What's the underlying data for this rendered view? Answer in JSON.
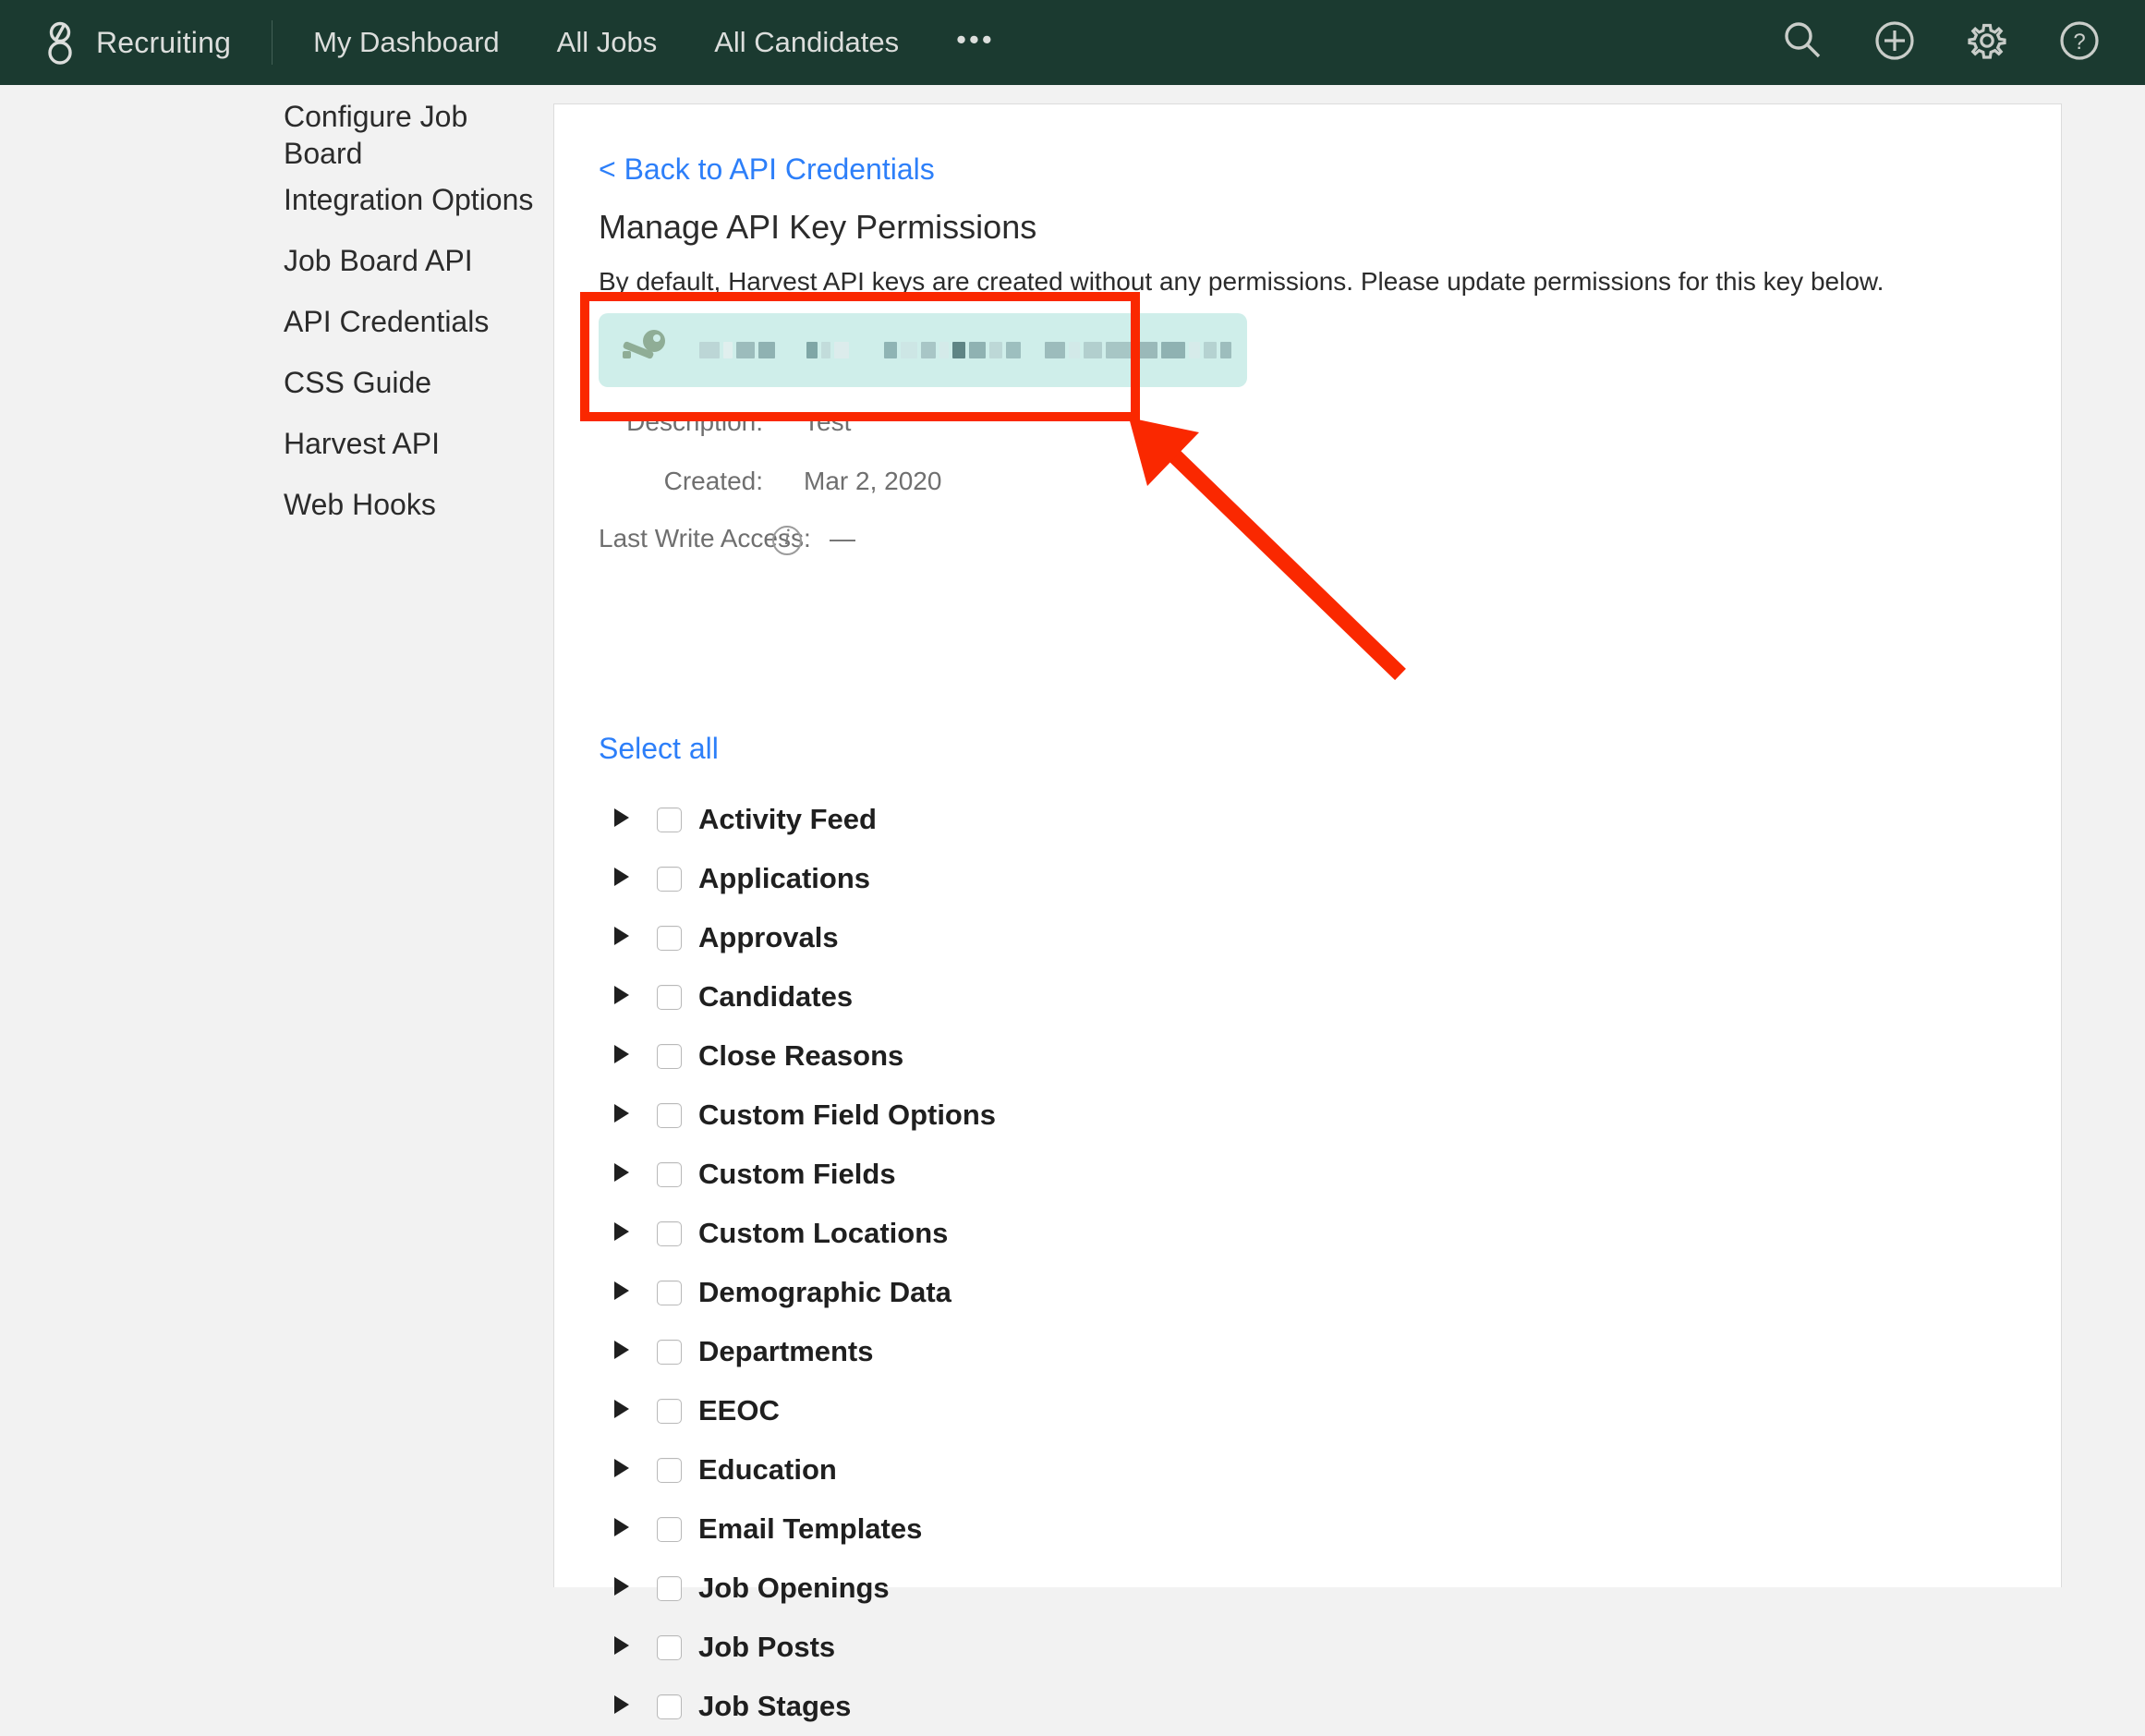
{
  "topnav": {
    "logo_icon": "greenhouse-logo-icon",
    "brand": "Recruiting",
    "links": [
      {
        "label": "My Dashboard"
      },
      {
        "label": "All Jobs"
      },
      {
        "label": "All Candidates"
      }
    ],
    "overflow_label": "•••",
    "icons": [
      {
        "name": "search-icon"
      },
      {
        "name": "add-circle-icon"
      },
      {
        "name": "gear-icon"
      },
      {
        "name": "help-circle-icon"
      }
    ],
    "bg_color": "#1b3a30",
    "text_color": "#dcdedc"
  },
  "sidebar": {
    "items": [
      {
        "label": "Configure Job Board"
      },
      {
        "label": "Integration Options"
      },
      {
        "label": "Job Board API"
      },
      {
        "label": "API Credentials"
      },
      {
        "label": "CSS Guide"
      },
      {
        "label": "Harvest API"
      },
      {
        "label": "Web Hooks"
      }
    ]
  },
  "main": {
    "back_link": "< Back to API Credentials",
    "title": "Manage API Key Permissions",
    "description": "By default, Harvest API keys are created without any permissions. Please update permissions for this key below.",
    "key_pill": {
      "icon": "key-icon",
      "value_masked": true,
      "bg_color": "#cfeeea"
    },
    "details": [
      {
        "label": "Description:",
        "value": "Test",
        "info": false
      },
      {
        "label": "Created:",
        "value": "Mar 2, 2020",
        "info": false
      },
      {
        "label": "Last Write Access:",
        "value": "—",
        "info": true,
        "info_icon": "info-circle-icon"
      }
    ],
    "select_all_label": "Select all",
    "permissions": [
      {
        "label": "Activity Feed",
        "checked": false,
        "expanded": false
      },
      {
        "label": "Applications",
        "checked": false,
        "expanded": false
      },
      {
        "label": "Approvals",
        "checked": false,
        "expanded": false
      },
      {
        "label": "Candidates",
        "checked": false,
        "expanded": false
      },
      {
        "label": "Close Reasons",
        "checked": false,
        "expanded": false
      },
      {
        "label": "Custom Field Options",
        "checked": false,
        "expanded": false
      },
      {
        "label": "Custom Fields",
        "checked": false,
        "expanded": false
      },
      {
        "label": "Custom Locations",
        "checked": false,
        "expanded": false
      },
      {
        "label": "Demographic Data",
        "checked": false,
        "expanded": false
      },
      {
        "label": "Departments",
        "checked": false,
        "expanded": false
      },
      {
        "label": "EEOC",
        "checked": false,
        "expanded": false
      },
      {
        "label": "Education",
        "checked": false,
        "expanded": false
      },
      {
        "label": "Email Templates",
        "checked": false,
        "expanded": false
      },
      {
        "label": "Job Openings",
        "checked": false,
        "expanded": false
      },
      {
        "label": "Job Posts",
        "checked": false,
        "expanded": false
      },
      {
        "label": "Job Stages",
        "checked": false,
        "expanded": false
      }
    ]
  },
  "annotation": {
    "color": "#fa2800",
    "box_target": "api-key-pill",
    "arrow_direction": "up-left"
  }
}
